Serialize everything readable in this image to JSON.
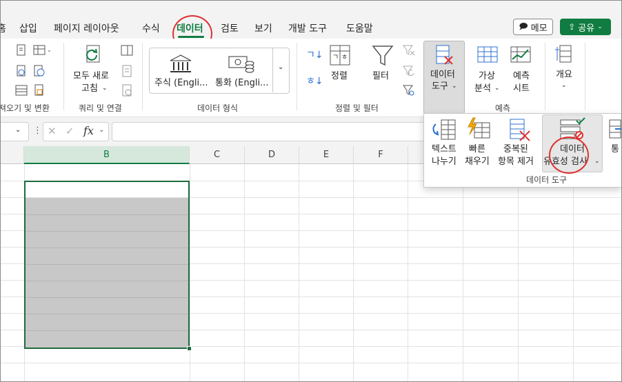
{
  "tabs": [
    "홈",
    "삽입",
    "페이지 레이아웃",
    "수식",
    "데이터",
    "검토",
    "보기",
    "개발 도구",
    "도움말"
  ],
  "active_tab": "데이터",
  "header": {
    "memo_label": "메모",
    "share_label": "공유"
  },
  "ribbon": {
    "get_data_group": "져오기 및 변환",
    "refresh_all": [
      "모두 새로",
      "고침"
    ],
    "queries_group": "쿼리 및 연결",
    "stock": "주식 (Engli...",
    "currency": "통화 (Engli...",
    "data_types_group": "데이터 형식",
    "sort_az": "ㄱ↓",
    "sort_za": "ㅎ↓",
    "sort": "정렬",
    "filter": "필터",
    "sort_filter_group": "정렬 및 필터",
    "data_tools": [
      "데이터",
      "도구"
    ],
    "what_if": [
      "가상",
      "분석"
    ],
    "forecast_sheet": [
      "예측",
      "시트"
    ],
    "forecast_group": "예측",
    "outline": "개요"
  },
  "formula_bar": {
    "fx": "fx",
    "value": ""
  },
  "columns": [
    "B",
    "C",
    "D",
    "E",
    "F"
  ],
  "selected_column": "B",
  "popup": {
    "text_to_columns": [
      "텍스트",
      "나누기"
    ],
    "flash_fill": [
      "빠른",
      "채우기"
    ],
    "remove_duplicates": [
      "중복된",
      "항목 제거"
    ],
    "data_validation": [
      "데이터",
      "유효성 검사"
    ],
    "consolidate": "통",
    "group_label": "데이터 도구"
  }
}
